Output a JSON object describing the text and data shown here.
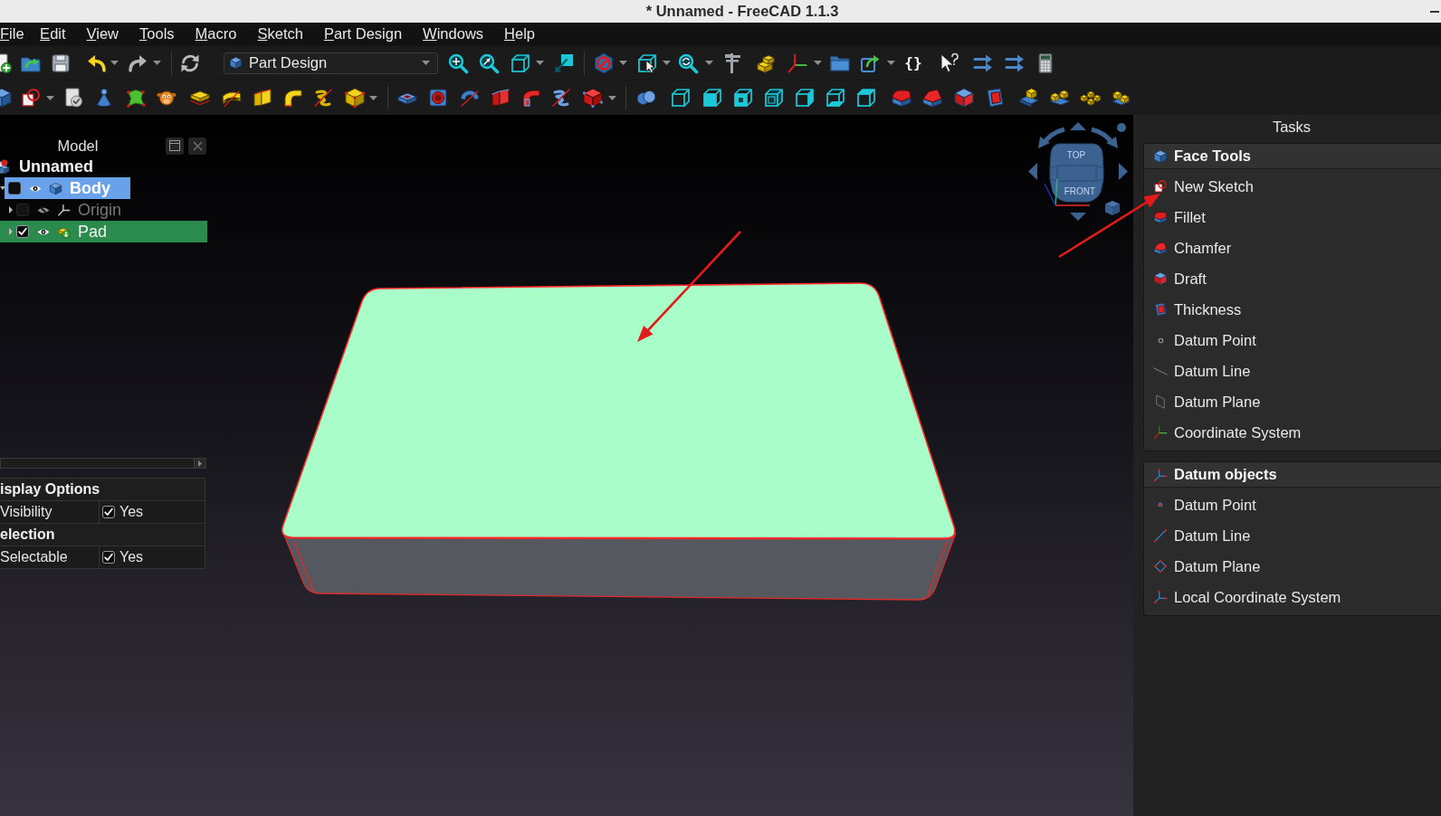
{
  "window": {
    "title": "* Unnamed - FreeCAD 1.1.3"
  },
  "menu_bar": [
    "File",
    "Edit",
    "View",
    "Tools",
    "Macro",
    "Sketch",
    "Part Design",
    "Windows",
    "Help"
  ],
  "toolbar": {
    "workbench": "Part Design",
    "braces_button": "{}"
  },
  "model_panel": {
    "title": "Model",
    "tree": [
      {
        "label": "Unnamed",
        "kind": "document",
        "selected": false,
        "active": false,
        "children": [
          {
            "label": "Body",
            "kind": "body",
            "expanded": true,
            "selected": false,
            "active": true,
            "checked": false,
            "visible": true,
            "children": [
              {
                "label": "Origin",
                "kind": "origin",
                "expanded": false,
                "selected": false,
                "active": false,
                "checked": false,
                "visible": false
              },
              {
                "label": "Pad",
                "kind": "pad",
                "expanded": false,
                "selected": true,
                "active": false,
                "checked": true,
                "visible": true
              }
            ]
          }
        ]
      }
    ]
  },
  "property_panel": {
    "groups": [
      {
        "label": "isplay Options",
        "rows": [
          {
            "name": "Visibility",
            "checked": true,
            "value": "Yes"
          }
        ]
      },
      {
        "label": "election",
        "rows": [
          {
            "name": "Selectable",
            "checked": true,
            "value": "Yes"
          }
        ]
      }
    ]
  },
  "navigation_cube": {
    "top_label": "TOP",
    "front_label": "FRONT"
  },
  "tasks_panel": {
    "title": "Tasks",
    "boxes": [
      {
        "title": "Face Tools",
        "kind": "features",
        "items": [
          {
            "label": "New Sketch",
            "kind": "sketch"
          },
          {
            "label": "Fillet",
            "kind": "fillet"
          },
          {
            "label": "Chamfer",
            "kind": "chamfer"
          },
          {
            "label": "Draft",
            "kind": "draft"
          },
          {
            "label": "Thickness",
            "kind": "thickness"
          },
          {
            "label": "Datum Point",
            "kind": "point_plain"
          },
          {
            "label": "Datum Line",
            "kind": "line_plain"
          },
          {
            "label": "Datum Plane",
            "kind": "plane_plain"
          },
          {
            "label": "Coordinate System",
            "kind": "coordinate_system"
          }
        ]
      },
      {
        "title": "Datum objects",
        "kind": "datums",
        "items": [
          {
            "label": "Datum Point",
            "kind": "point"
          },
          {
            "label": "Datum Line",
            "kind": "line"
          },
          {
            "label": "Datum Plane",
            "kind": "plane"
          },
          {
            "label": "Local Coordinate System",
            "kind": "local_coordinate_system"
          }
        ]
      }
    ]
  }
}
